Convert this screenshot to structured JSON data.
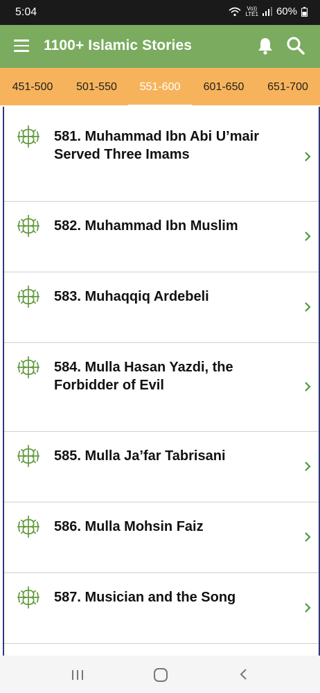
{
  "status_bar": {
    "time": "5:04",
    "volte_top": "Vo))",
    "volte_bottom": "LTE1",
    "battery": "60%"
  },
  "app_bar": {
    "title": "1100+ Islamic Stories",
    "menu_icon": "hamburger-menu-icon",
    "bell_icon": "bell-icon",
    "search_icon": "search-icon",
    "background": "#7aab5f"
  },
  "tabs": {
    "background": "#f7b35b",
    "items": [
      {
        "label": "451-500"
      },
      {
        "label": "501-550"
      },
      {
        "label": "551-600",
        "selected": true
      },
      {
        "label": "601-650"
      },
      {
        "label": "651-700"
      }
    ]
  },
  "stories": [
    {
      "title": "581. Muhammad Ibn Abi U’mair Served Three Imams"
    },
    {
      "title": "582. Muhammad Ibn Muslim"
    },
    {
      "title": "583. Muhaqqiq Ardebeli"
    },
    {
      "title": "584. Mulla Hasan Yazdi, the Forbidder of Evil"
    },
    {
      "title": "585. Mulla Ja’far Tabrisani"
    },
    {
      "title": "586. Mulla Mohsin Faiz"
    },
    {
      "title": "587. Musician and the Song"
    }
  ],
  "item_icon": "islamic-ornament-icon",
  "chevron_color": "#4a9a3c"
}
